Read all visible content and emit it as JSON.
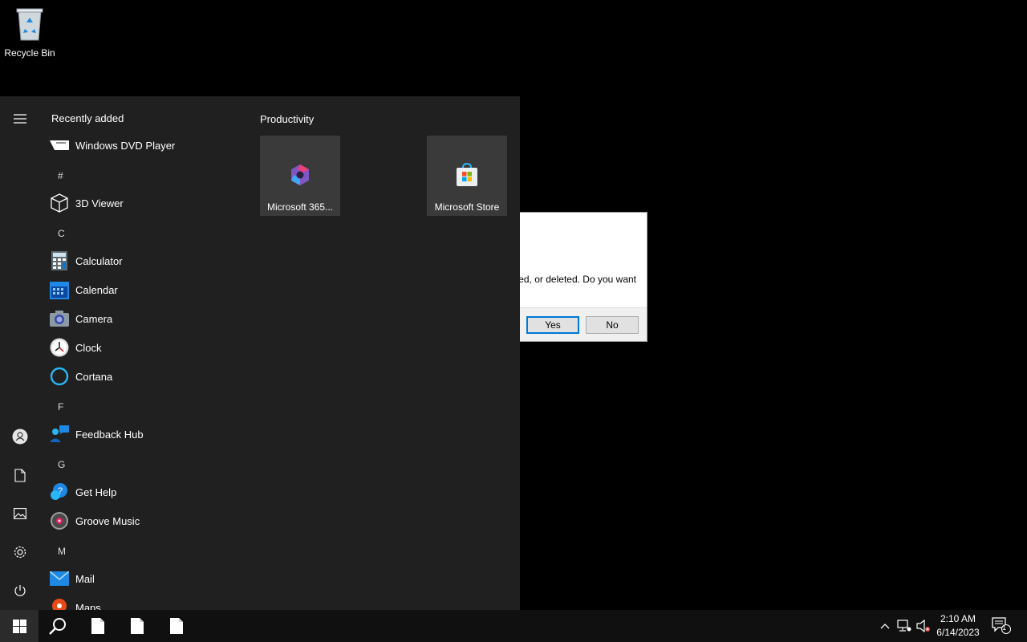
{
  "desktop": {
    "recycle_bin_label": "Recycle Bin"
  },
  "dialog": {
    "message": "ed, or deleted. Do you want",
    "yes_label": "Yes",
    "no_label": "No"
  },
  "start_menu": {
    "recently_added_label": "Recently added",
    "apps": [
      {
        "type": "app",
        "label": "Windows DVD Player",
        "icon": "dvd-icon"
      },
      {
        "type": "letter",
        "label": "#"
      },
      {
        "type": "app",
        "label": "3D Viewer",
        "icon": "cube-icon"
      },
      {
        "type": "letter",
        "label": "C"
      },
      {
        "type": "app",
        "label": "Calculator",
        "icon": "calculator-icon"
      },
      {
        "type": "app",
        "label": "Calendar",
        "icon": "calendar-icon"
      },
      {
        "type": "app",
        "label": "Camera",
        "icon": "camera-icon"
      },
      {
        "type": "app",
        "label": "Clock",
        "icon": "clock-icon"
      },
      {
        "type": "app",
        "label": "Cortana",
        "icon": "cortana-icon"
      },
      {
        "type": "letter",
        "label": "F"
      },
      {
        "type": "app",
        "label": "Feedback Hub",
        "icon": "feedback-icon"
      },
      {
        "type": "letter",
        "label": "G"
      },
      {
        "type": "app",
        "label": "Get Help",
        "icon": "help-icon"
      },
      {
        "type": "app",
        "label": "Groove Music",
        "icon": "music-icon"
      },
      {
        "type": "letter",
        "label": "M"
      },
      {
        "type": "app",
        "label": "Mail",
        "icon": "mail-icon"
      },
      {
        "type": "app",
        "label": "Maps",
        "icon": "maps-icon"
      }
    ],
    "tile_group_title": "Productivity",
    "tiles": [
      {
        "label": "Microsoft 365...",
        "icon": "microsoft-365-icon"
      },
      {
        "label": "Microsoft Store",
        "icon": "store-icon"
      }
    ]
  },
  "taskbar": {
    "time": "2:10 AM",
    "date": "6/14/2023",
    "notification_count": "1"
  }
}
